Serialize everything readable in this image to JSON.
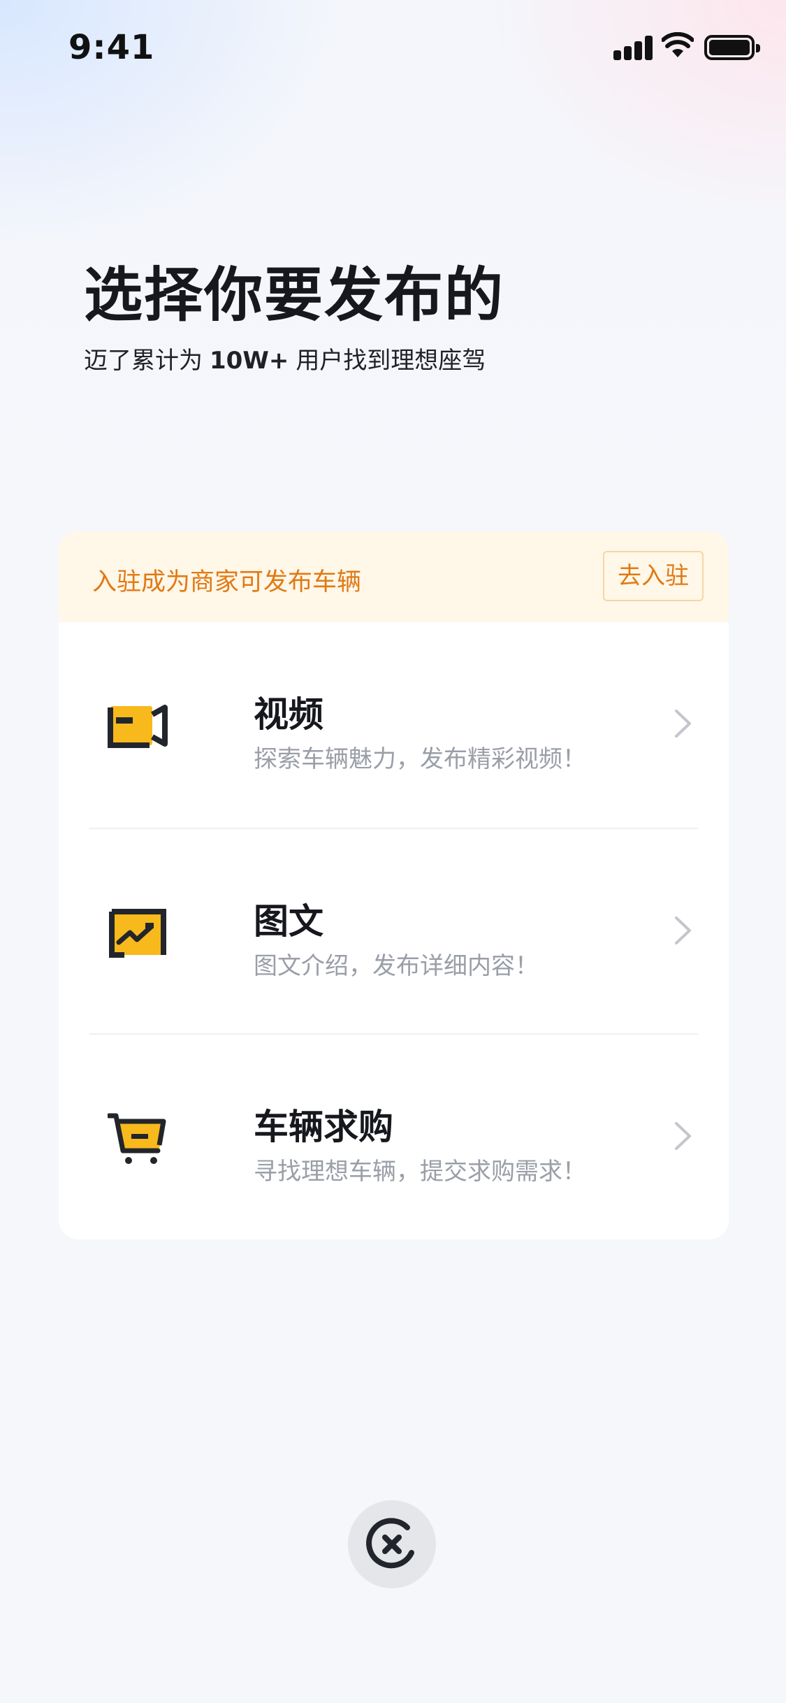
{
  "status_bar": {
    "time": "9:41"
  },
  "header": {
    "title": "选择你要发布的",
    "subtitle_prefix": "迈了累计为",
    "subtitle_highlight": "10W+",
    "subtitle_suffix": "用户找到理想座驾"
  },
  "merchant_banner": {
    "text": "入驻成为商家可发布车辆",
    "button_label": "去入驻"
  },
  "options": [
    {
      "icon": "video-camera-icon",
      "title": "视频",
      "description": "探索车辆魅力，发布精彩视频！"
    },
    {
      "icon": "image-text-icon",
      "title": "图文",
      "description": "图文介绍，发布详细内容！"
    },
    {
      "icon": "shopping-cart-icon",
      "title": "车辆求购",
      "description": "寻找理想车辆，提交求购需求！"
    }
  ],
  "colors": {
    "accent_orange": "#e07a14",
    "icon_yellow": "#f7b91b",
    "banner_bg": "#fff7e8"
  }
}
